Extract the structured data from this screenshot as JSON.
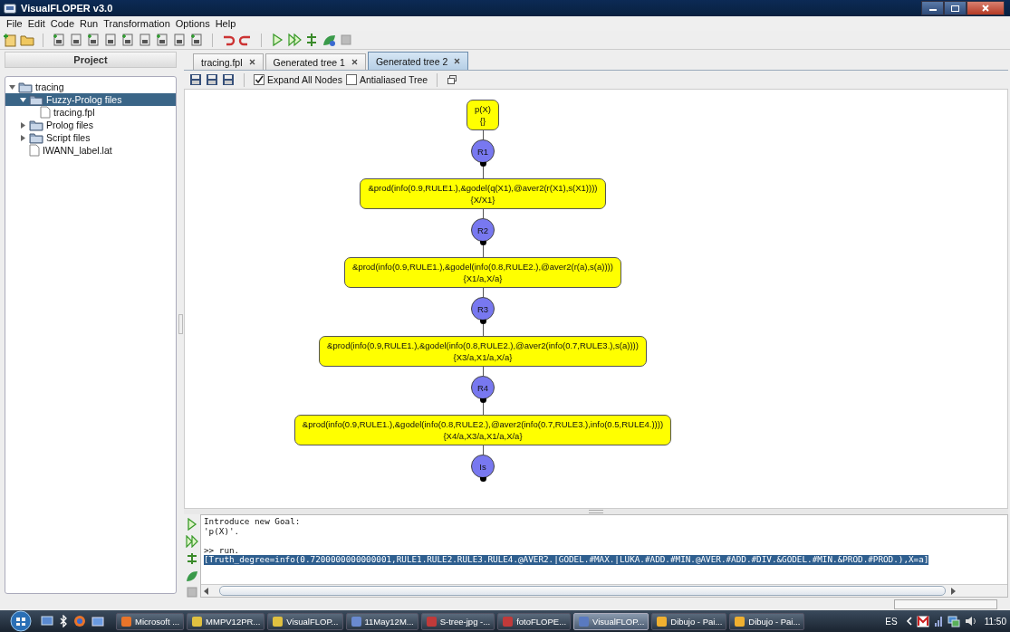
{
  "window": {
    "title": "VisualFLOPER v3.0"
  },
  "menu": [
    "File",
    "Edit",
    "Code",
    "Run",
    "Transformation",
    "Options",
    "Help"
  ],
  "project": {
    "title": "Project",
    "tree": [
      {
        "label": "tracing",
        "kind": "folder",
        "expanded": true,
        "selected": false,
        "children": [
          {
            "label": "Fuzzy-Prolog files",
            "kind": "folder",
            "expanded": true,
            "selected": true,
            "children": [
              {
                "label": "tracing.fpl",
                "kind": "file",
                "selected": false
              }
            ]
          },
          {
            "label": "Prolog files",
            "kind": "folder",
            "expanded": false,
            "selected": false
          },
          {
            "label": "Script files",
            "kind": "folder",
            "expanded": false,
            "selected": false
          },
          {
            "label": "IWANN_label.lat",
            "kind": "file",
            "selected": false
          }
        ]
      }
    ]
  },
  "tabs": [
    {
      "label": "tracing.fpl",
      "selected": false
    },
    {
      "label": "Generated tree 1",
      "selected": false
    },
    {
      "label": "Generated tree 2",
      "selected": true
    }
  ],
  "options": [
    {
      "label": "Expand All Nodes",
      "checked": true
    },
    {
      "label": "Antialiased Tree",
      "checked": false
    }
  ],
  "tree": [
    {
      "kind": "state",
      "goal": "p(X)",
      "subst": "{}"
    },
    {
      "kind": "step",
      "label": "R1"
    },
    {
      "kind": "state",
      "goal": "&prod(info(0.9,RULE1.),&godel(q(X1),@aver2(r(X1),s(X1))))",
      "subst": "{X/X1}"
    },
    {
      "kind": "step",
      "label": "R2"
    },
    {
      "kind": "state",
      "goal": "&prod(info(0.9,RULE1.),&godel(info(0.8,RULE2.),@aver2(r(a),s(a))))",
      "subst": "{X1/a,X/a}"
    },
    {
      "kind": "step",
      "label": "R3"
    },
    {
      "kind": "state",
      "goal": "&prod(info(0.9,RULE1.),&godel(info(0.8,RULE2.),@aver2(info(0.7,RULE3.),s(a))))",
      "subst": "{X3/a,X1/a,X/a}"
    },
    {
      "kind": "step",
      "label": "R4"
    },
    {
      "kind": "state",
      "goal": "&prod(info(0.9,RULE1.),&godel(info(0.8,RULE2.),@aver2(info(0.7,RULE3.),info(0.5,RULE4.))))",
      "subst": "{X4/a,X3/a,X1/a,X/a}"
    },
    {
      "kind": "step",
      "label": "Is"
    }
  ],
  "console": [
    {
      "kind": "output",
      "text": "Introduce new Goal:",
      "selected": false
    },
    {
      "kind": "output",
      "text": "'p(X)'.",
      "selected": false
    },
    {
      "kind": "command",
      "text": ">> run.",
      "selected": false
    },
    {
      "text": "[Truth_degree=info(0.7200000000000001,RULE1.RULE2.RULE3.RULE4.@AVER2.|GODEL.#MAX.|LUKA.#ADD.#MIN.@AVER.#ADD.#DIV.&GODEL.#MIN.&PROD.#PROD.),X=a]",
      "kind": "output",
      "selected": true
    }
  ],
  "status": {
    "progress": {
      "level": 0
    }
  },
  "taskbar": {
    "items": [
      {
        "label": "Microsoft ...",
        "selected": false
      },
      {
        "label": "MMPV12PR...",
        "selected": false
      },
      {
        "label": "VisualFLOP...",
        "selected": false
      },
      {
        "label": "11May12M...",
        "selected": false
      },
      {
        "label": "S-tree-jpg -...",
        "selected": false
      },
      {
        "label": "fotoFLOPE...",
        "selected": false
      },
      {
        "label": "VisualFLOP...",
        "selected": true
      },
      {
        "label": "Dibujo - Pai...",
        "selected": false
      },
      {
        "label": "Dibujo - Pai...",
        "selected": false
      }
    ],
    "language": "ES",
    "clock": "11:50"
  }
}
